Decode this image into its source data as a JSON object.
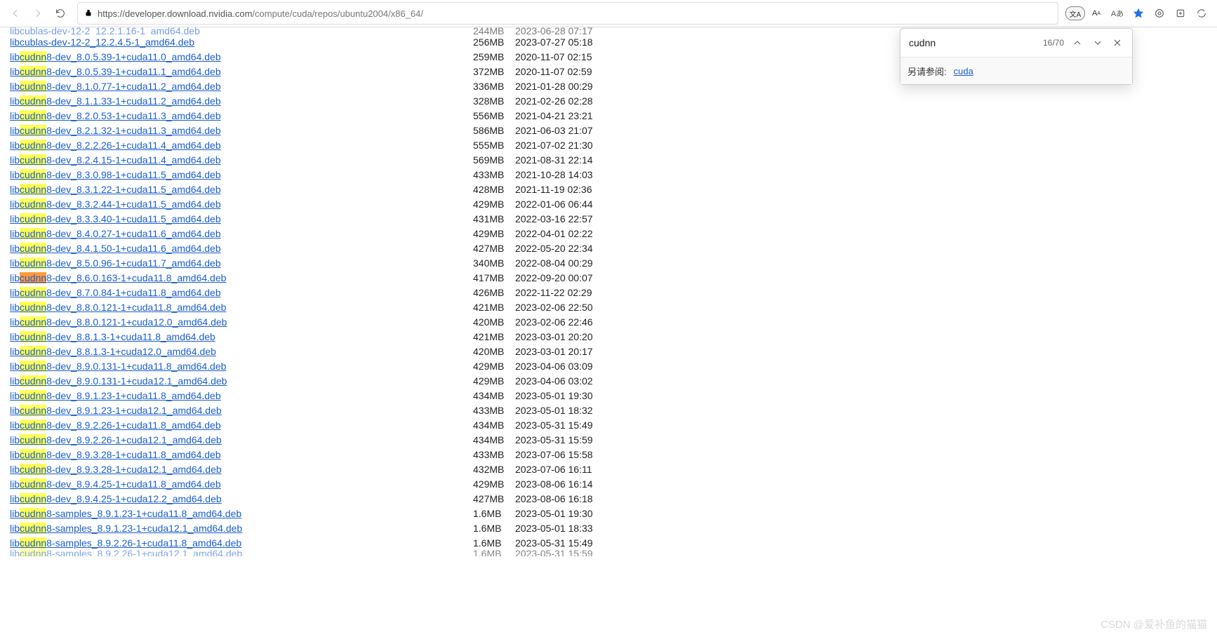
{
  "chrome": {
    "url_host": "https://developer.download.nvidia.com",
    "url_path": "/compute/cuda/repos/ubuntu2004/x86_64/",
    "aa_label": "Aあ"
  },
  "find": {
    "query": "cudnn",
    "count": "16/70",
    "suggest_label": "另请参阅:",
    "suggest_link": "cuda"
  },
  "cutoff_top": {
    "prefix": "libcublas-dev-12-2_12.2.1.16-1_amd64.deb",
    "size": "244MB",
    "date": "2023-06-28 07:17"
  },
  "files": [
    {
      "prefix": "libcublas-dev-12-2_12.2.4.5-1_amd64.deb",
      "hl": "",
      "suffix": "",
      "size": "256MB",
      "date": "2023-07-27 05:18"
    },
    {
      "prefix": "lib",
      "hl": "cudnn",
      "suffix": "8-dev_8.0.5.39-1+cuda11.0_amd64.deb",
      "size": "259MB",
      "date": "2020-11-07 02:15"
    },
    {
      "prefix": "lib",
      "hl": "cudnn",
      "suffix": "8-dev_8.0.5.39-1+cuda11.1_amd64.deb",
      "size": "372MB",
      "date": "2020-11-07 02:59"
    },
    {
      "prefix": "lib",
      "hl": "cudnn",
      "suffix": "8-dev_8.1.0.77-1+cuda11.2_amd64.deb",
      "size": "336MB",
      "date": "2021-01-28 00:29"
    },
    {
      "prefix": "lib",
      "hl": "cudnn",
      "suffix": "8-dev_8.1.1.33-1+cuda11.2_amd64.deb",
      "size": "328MB",
      "date": "2021-02-26 02:28"
    },
    {
      "prefix": "lib",
      "hl": "cudnn",
      "suffix": "8-dev_8.2.0.53-1+cuda11.3_amd64.deb",
      "size": "556MB",
      "date": "2021-04-21 23:21"
    },
    {
      "prefix": "lib",
      "hl": "cudnn",
      "suffix": "8-dev_8.2.1.32-1+cuda11.3_amd64.deb",
      "size": "586MB",
      "date": "2021-06-03 21:07"
    },
    {
      "prefix": "lib",
      "hl": "cudnn",
      "suffix": "8-dev_8.2.2.26-1+cuda11.4_amd64.deb",
      "size": "555MB",
      "date": "2021-07-02 21:30"
    },
    {
      "prefix": "lib",
      "hl": "cudnn",
      "suffix": "8-dev_8.2.4.15-1+cuda11.4_amd64.deb",
      "size": "569MB",
      "date": "2021-08-31 22:14"
    },
    {
      "prefix": "lib",
      "hl": "cudnn",
      "suffix": "8-dev_8.3.0.98-1+cuda11.5_amd64.deb",
      "size": "433MB",
      "date": "2021-10-28 14:03"
    },
    {
      "prefix": "lib",
      "hl": "cudnn",
      "suffix": "8-dev_8.3.1.22-1+cuda11.5_amd64.deb",
      "size": "428MB",
      "date": "2021-11-19 02:36"
    },
    {
      "prefix": "lib",
      "hl": "cudnn",
      "suffix": "8-dev_8.3.2.44-1+cuda11.5_amd64.deb",
      "size": "429MB",
      "date": "2022-01-06 06:44"
    },
    {
      "prefix": "lib",
      "hl": "cudnn",
      "suffix": "8-dev_8.3.3.40-1+cuda11.5_amd64.deb",
      "size": "431MB",
      "date": "2022-03-16 22:57"
    },
    {
      "prefix": "lib",
      "hl": "cudnn",
      "suffix": "8-dev_8.4.0.27-1+cuda11.6_amd64.deb",
      "size": "429MB",
      "date": "2022-04-01 02:22"
    },
    {
      "prefix": "lib",
      "hl": "cudnn",
      "suffix": "8-dev_8.4.1.50-1+cuda11.6_amd64.deb",
      "size": "427MB",
      "date": "2022-05-20 22:34"
    },
    {
      "prefix": "lib",
      "hl": "cudnn",
      "suffix": "8-dev_8.5.0.96-1+cuda11.7_amd64.deb",
      "size": "340MB",
      "date": "2022-08-04 00:29"
    },
    {
      "prefix": "lib",
      "hl": "cudnn",
      "suffix": "8-dev_8.6.0.163-1+cuda11.8_amd64.deb",
      "size": "417MB",
      "date": "2022-09-20 00:07",
      "current": true
    },
    {
      "prefix": "lib",
      "hl": "cudnn",
      "suffix": "8-dev_8.7.0.84-1+cuda11.8_amd64.deb",
      "size": "426MB",
      "date": "2022-11-22 02:29"
    },
    {
      "prefix": "lib",
      "hl": "cudnn",
      "suffix": "8-dev_8.8.0.121-1+cuda11.8_amd64.deb",
      "size": "421MB",
      "date": "2023-02-06 22:50"
    },
    {
      "prefix": "lib",
      "hl": "cudnn",
      "suffix": "8-dev_8.8.0.121-1+cuda12.0_amd64.deb",
      "size": "420MB",
      "date": "2023-02-06 22:46"
    },
    {
      "prefix": "lib",
      "hl": "cudnn",
      "suffix": "8-dev_8.8.1.3-1+cuda11.8_amd64.deb",
      "size": "421MB",
      "date": "2023-03-01 20:20"
    },
    {
      "prefix": "lib",
      "hl": "cudnn",
      "suffix": "8-dev_8.8.1.3-1+cuda12.0_amd64.deb",
      "size": "420MB",
      "date": "2023-03-01 20:17"
    },
    {
      "prefix": "lib",
      "hl": "cudnn",
      "suffix": "8-dev_8.9.0.131-1+cuda11.8_amd64.deb",
      "size": "429MB",
      "date": "2023-04-06 03:09"
    },
    {
      "prefix": "lib",
      "hl": "cudnn",
      "suffix": "8-dev_8.9.0.131-1+cuda12.1_amd64.deb",
      "size": "429MB",
      "date": "2023-04-06 03:02"
    },
    {
      "prefix": "lib",
      "hl": "cudnn",
      "suffix": "8-dev_8.9.1.23-1+cuda11.8_amd64.deb",
      "size": "434MB",
      "date": "2023-05-01 19:30"
    },
    {
      "prefix": "lib",
      "hl": "cudnn",
      "suffix": "8-dev_8.9.1.23-1+cuda12.1_amd64.deb",
      "size": "433MB",
      "date": "2023-05-01 18:32"
    },
    {
      "prefix": "lib",
      "hl": "cudnn",
      "suffix": "8-dev_8.9.2.26-1+cuda11.8_amd64.deb",
      "size": "434MB",
      "date": "2023-05-31 15:49"
    },
    {
      "prefix": "lib",
      "hl": "cudnn",
      "suffix": "8-dev_8.9.2.26-1+cuda12.1_amd64.deb",
      "size": "434MB",
      "date": "2023-05-31 15:59"
    },
    {
      "prefix": "lib",
      "hl": "cudnn",
      "suffix": "8-dev_8.9.3.28-1+cuda11.8_amd64.deb",
      "size": "433MB",
      "date": "2023-07-06 15:58"
    },
    {
      "prefix": "lib",
      "hl": "cudnn",
      "suffix": "8-dev_8.9.3.28-1+cuda12.1_amd64.deb",
      "size": "432MB",
      "date": "2023-07-06 16:11"
    },
    {
      "prefix": "lib",
      "hl": "cudnn",
      "suffix": "8-dev_8.9.4.25-1+cuda11.8_amd64.deb",
      "size": "429MB",
      "date": "2023-08-06 16:14"
    },
    {
      "prefix": "lib",
      "hl": "cudnn",
      "suffix": "8-dev_8.9.4.25-1+cuda12.2_amd64.deb",
      "size": "427MB",
      "date": "2023-08-06 16:18"
    },
    {
      "prefix": "lib",
      "hl": "cudnn",
      "suffix": "8-samples_8.9.1.23-1+cuda11.8_amd64.deb",
      "size": "1.6MB",
      "date": "2023-05-01 19:30"
    },
    {
      "prefix": "lib",
      "hl": "cudnn",
      "suffix": "8-samples_8.9.1.23-1+cuda12.1_amd64.deb",
      "size": "1.6MB",
      "date": "2023-05-01 18:33"
    },
    {
      "prefix": "lib",
      "hl": "cudnn",
      "suffix": "8-samples_8.9.2.26-1+cuda11.8_amd64.deb",
      "size": "1.6MB",
      "date": "2023-05-31 15:49"
    }
  ],
  "cutoff_bottom": {
    "prefix": "lib",
    "hl": "cudnn",
    "suffix": "8-samples_8.9.2.26-1+cuda12.1_amd64.deb",
    "size": "1.6MB",
    "date": "2023-05-31 15:59"
  },
  "watermark": "CSDN @爱补鱼的猫猫"
}
